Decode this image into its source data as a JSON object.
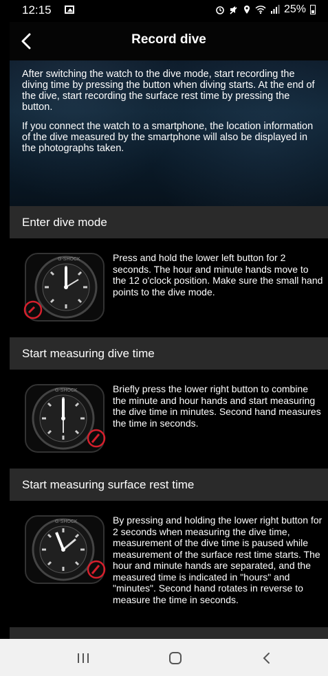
{
  "status": {
    "time": "12:15",
    "battery": "25%"
  },
  "appbar": {
    "title": "Record dive"
  },
  "intro": {
    "p1": "After switching the watch to the dive mode, start recording the diving time by pressing the button when diving starts. At the end of the dive, start recording the surface rest time by pressing the button.",
    "p2": "If you connect the watch to a smartphone, the location information of the dive measured by the smartphone will also be displayed in the photographs taken."
  },
  "sections": [
    {
      "title": "Enter dive mode",
      "text": "Press and hold the lower left button for 2 seconds. The hour and minute hands move to the 12 o'clock position. Make sure the small hand points to the dive mode."
    },
    {
      "title": "Start measuring dive time",
      "text": "Briefly press the lower right button to combine the minute and hour hands and start measuring the dive time in minutes. Second hand measures the time in seconds."
    },
    {
      "title": "Start measuring surface rest time",
      "text": "By pressing and holding the lower right button for 2 seconds when measuring the dive time, measurement of the dive time is paused while measurement of the surface rest time starts. The hour and minute hands are separated, and the measured time is indicated in \"hours\" and \"minutes\". Second hand rotates in reverse to measure the time in seconds."
    }
  ],
  "watch": {
    "brand": "G-SHOCK"
  },
  "colors": {
    "highlight": "#d61f2c",
    "section_header": "#2a2a2a"
  }
}
